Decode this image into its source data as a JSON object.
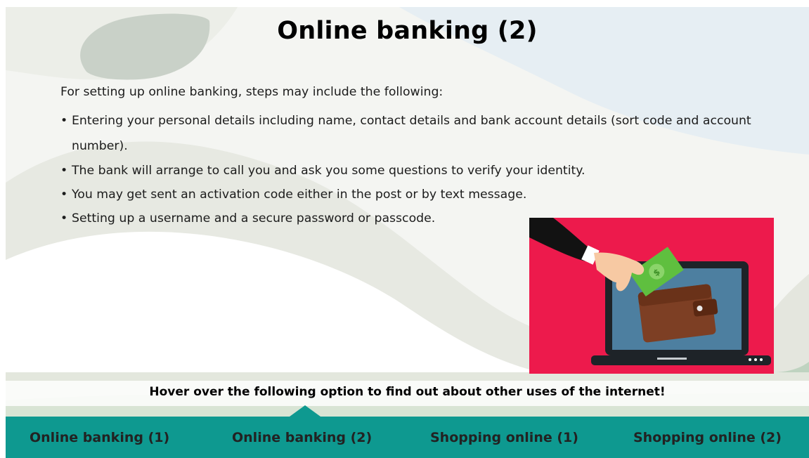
{
  "slide": {
    "title": "Online banking (2)",
    "intro": "For setting up online banking, steps may include the following:",
    "bullets": [
      "Entering your personal details including name, contact details and bank account details (sort code and account number).",
      "The bank will arrange to call you and ask you some questions to verify your identity.",
      "You may get sent an activation code either in the post or by text message.",
      "Setting up a username and a secure password or passcode."
    ],
    "hover_prompt": "Hover over the following option to find out about other uses of the internet!"
  },
  "nav": {
    "items": [
      {
        "label": "Online banking (1)"
      },
      {
        "label": "Online banking (2)"
      },
      {
        "label": "Shopping online (1)"
      },
      {
        "label": "Shopping online (2)"
      }
    ]
  },
  "colors": {
    "nav_bg": "#0e9990",
    "picture_bg": "#ed1a4c",
    "laptop_screen": "#4d7fa0",
    "wallet": "#7d3f24",
    "banknote": "#5fbf3f",
    "background_shape": "#e4e6de",
    "leaf_shape": "#c9d1c8",
    "sky_shape": "#e6eef3"
  },
  "icons": {
    "picture": "laptop-wallet-payment-illustration"
  }
}
